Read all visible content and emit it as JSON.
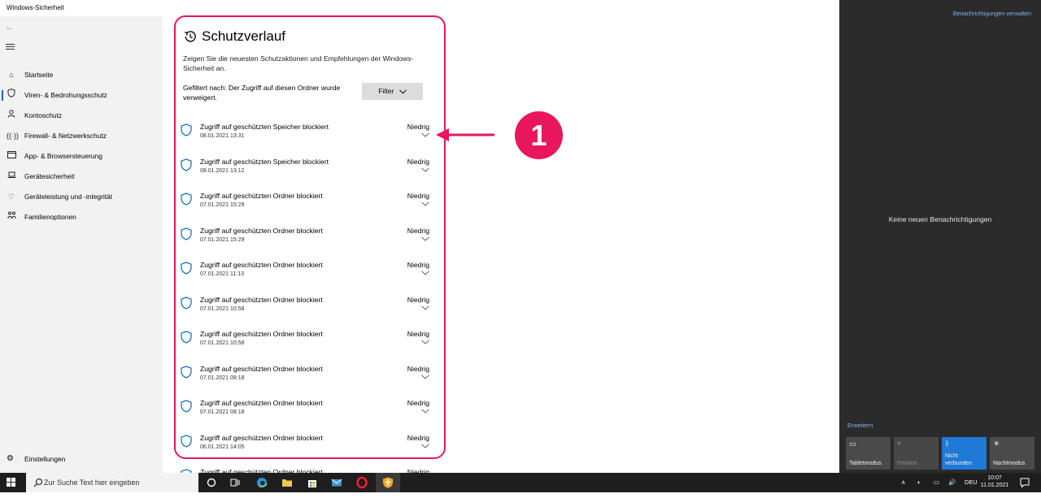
{
  "window": {
    "title": "Windows-Sicherheit"
  },
  "sidebar": {
    "items": [
      {
        "label": "Startseite",
        "icon": "home-icon"
      },
      {
        "label": "Viren- & Bedrohungsschutz",
        "icon": "shield-icon",
        "active": true
      },
      {
        "label": "Kontoschutz",
        "icon": "person-icon"
      },
      {
        "label": "Firewall- & Netzwerkschutz",
        "icon": "wifi-icon"
      },
      {
        "label": "App- & Browsersteuerung",
        "icon": "window-icon"
      },
      {
        "label": "Gerätesicherheit",
        "icon": "laptop-icon"
      },
      {
        "label": "Geräteleistung und -integrität",
        "icon": "heart-icon"
      },
      {
        "label": "Familienoptionen",
        "icon": "family-icon"
      }
    ],
    "settings": "Einstellungen"
  },
  "main": {
    "title": "Schutzverlauf",
    "description": "Zeigen Sie die neuesten Schutzaktionen und Empfehlungen der Windows-Sicherheit an.",
    "filter_text": "Gefiltert nach: Der Zugriff auf diesen Ordner wurde verweigert.",
    "filter_button": "Filter",
    "items": [
      {
        "title": "Zugriff auf geschützten Speicher blockiert",
        "date": "08.01.2021 13:31",
        "level": "Niedrig"
      },
      {
        "title": "Zugriff auf geschützten Speicher blockiert",
        "date": "08.01.2021 13:12",
        "level": "Niedrig"
      },
      {
        "title": "Zugriff auf geschützten Ordner blockiert",
        "date": "07.01.2021 15:29",
        "level": "Niedrig"
      },
      {
        "title": "Zugriff auf geschützten Ordner blockiert",
        "date": "07.01.2021 15:29",
        "level": "Niedrig"
      },
      {
        "title": "Zugriff auf geschützten Ordner blockiert",
        "date": "07.01.2021 11:13",
        "level": "Niedrig"
      },
      {
        "title": "Zugriff auf geschützten Ordner blockiert",
        "date": "07.01.2021 10:58",
        "level": "Niedrig"
      },
      {
        "title": "Zugriff auf geschützten Ordner blockiert",
        "date": "07.01.2021 10:58",
        "level": "Niedrig"
      },
      {
        "title": "Zugriff auf geschützten Ordner blockiert",
        "date": "07.01.2021 08:18",
        "level": "Niedrig"
      },
      {
        "title": "Zugriff auf geschützten Ordner blockiert",
        "date": "07.01.2021 08:18",
        "level": "Niedrig"
      },
      {
        "title": "Zugriff auf geschützten Ordner blockiert",
        "date": "06.01.2021 14:05",
        "level": "Niedrig"
      },
      {
        "title": "Zugriff auf geschützten Ordner blockiert",
        "date": "",
        "level": "Niedrig"
      }
    ]
  },
  "annotation": {
    "badge": "1",
    "color": "#e8175d"
  },
  "action_center": {
    "manage_link": "Benachrichtigungen verwalten",
    "empty_text": "Keine neuen Benachrichtigungen",
    "expand_link": "Erweitern",
    "tiles": [
      {
        "label": "Tabletmodus",
        "icon": "tablet-icon",
        "state": "off"
      },
      {
        "label": "Position",
        "icon": "location-icon",
        "state": "disabled"
      },
      {
        "label": "Nicht verbunden",
        "icon": "bluetooth-icon",
        "state": "on"
      },
      {
        "label": "Nachtmodus",
        "icon": "brightness-icon",
        "state": "off"
      }
    ]
  },
  "taskbar": {
    "search_placeholder": "Zur Suche Text hier eingeben",
    "language": "DEU",
    "time": "10:07",
    "date": "11.01.2021"
  },
  "colors": {
    "accent": "#0067c0",
    "highlight": "#e8175d",
    "shield": "#1a73c8"
  }
}
